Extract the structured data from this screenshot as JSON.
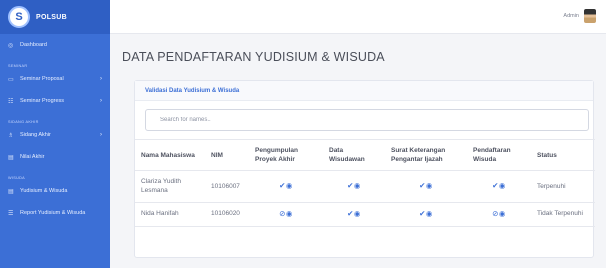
{
  "brand": {
    "logo_letter": "S",
    "name": "POLSUB"
  },
  "sidebar": {
    "items": [
      {
        "icon": "dashboard-icon",
        "glyph": "◎",
        "label": "Dashboard",
        "chevron": false
      },
      {
        "section": "SEMINAR"
      },
      {
        "icon": "seminar-proposal-icon",
        "glyph": "▭",
        "label": "Seminar Proposal",
        "chevron": true
      },
      {
        "icon": "seminar-progress-icon",
        "glyph": "☷",
        "label": "Seminar Progress",
        "chevron": true
      },
      {
        "section": "SIDANG AKHIR"
      },
      {
        "icon": "sidang-akhir-icon",
        "glyph": "♗",
        "label": "Sidang Akhir",
        "chevron": true
      },
      {
        "icon": "nilai-akhir-icon",
        "glyph": "▤",
        "label": "Nilai Akhir",
        "chevron": false
      },
      {
        "section": "WISUDA"
      },
      {
        "icon": "yudisium-wisuda-icon",
        "glyph": "▤",
        "label": "Yudisium & Wisuda",
        "chevron": false
      },
      {
        "icon": "report-icon",
        "glyph": "☰",
        "label": "Report Yudisium & Wisuda",
        "chevron": false
      }
    ]
  },
  "topbar": {
    "user_name": "Admin"
  },
  "page_title": "DATA PENDAFTARAN YUDISIUM & WISUDA",
  "card": {
    "title": "Validasi Data Yudisium & Wisuda",
    "search_placeholder": "Search for names..",
    "columns": [
      "Nama Mahasiswa",
      "NIM",
      "Pengumpulan Proyek Akhir",
      "Data Wisudawan",
      "Surat Keterangan Pengantar Ijazah",
      "Pendaftaran Wisuda",
      "Status"
    ],
    "rows": [
      {
        "nama": "Clariza Yudith Lesmana",
        "nim": "10106007",
        "proyek": "✔◉",
        "data": "✔◉",
        "surat": "✔◉",
        "daftar": "✔◉",
        "status": "Terpenuhi"
      },
      {
        "nama": "Nida Hanifah",
        "nim": "10106020",
        "proyek": "⊘◉",
        "data": "✔◉",
        "surat": "✔◉",
        "daftar": "⊘◉",
        "status": "Tidak Terpenuhi"
      }
    ]
  },
  "colors": {
    "sidebar": "#3c6fd6",
    "accent": "#3c6fd6"
  }
}
